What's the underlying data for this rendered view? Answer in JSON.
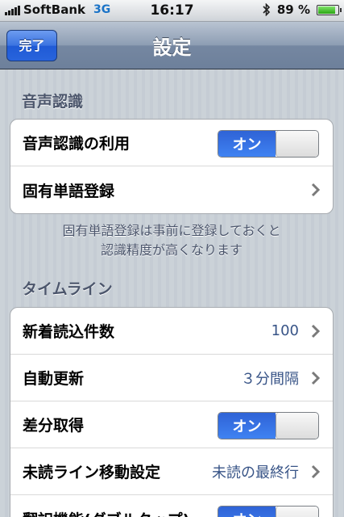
{
  "status_bar": {
    "carrier": "SoftBank",
    "network": "3G",
    "time": "16:17",
    "battery_percent": "89 %",
    "battery_level": 0.89,
    "bluetooth_icon": "bluetooth-icon"
  },
  "nav": {
    "title": "設定",
    "done_label": "完了"
  },
  "voice": {
    "header": "音声認識",
    "rows": [
      {
        "label": "音声認識の利用",
        "toggle": "オン"
      },
      {
        "label": "固有単語登録"
      }
    ],
    "footer_line1": "固有単語登録は事前に登録しておくと",
    "footer_line2": "認識精度が高くなります"
  },
  "timeline": {
    "header": "タイムライン",
    "rows": [
      {
        "label": "新着読込件数",
        "value": "100"
      },
      {
        "label": "自動更新",
        "value": "３分間隔"
      },
      {
        "label": "差分取得",
        "toggle": "オン"
      },
      {
        "label": "未読ライン移動設定",
        "value": "未読の最終行"
      },
      {
        "label": "翻訳機能(ダブルタップ)",
        "toggle": "オン"
      }
    ]
  },
  "colors": {
    "accent_blue": "#3f82f2",
    "value_text": "#385487",
    "header_text": "#4c566c"
  }
}
